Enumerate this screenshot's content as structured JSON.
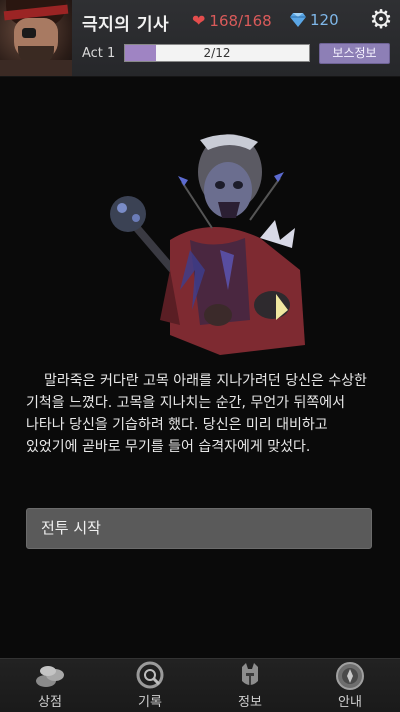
{
  "header": {
    "title": "극지의 기사",
    "hp": "168/168",
    "gems": "120",
    "act_label": "Act 1",
    "progress_text": "2/12",
    "progress_fraction": 0.1667,
    "boss_info_button": "보스정보",
    "icons": {
      "hp": "heart-icon",
      "gems": "diamond-icon",
      "settings": "gear-icon"
    },
    "colors": {
      "hp": "#e44d4d",
      "gems": "#7fb7e9",
      "progress_fill": "#9f84c3",
      "boss_button": "#8d7fb6"
    }
  },
  "story": {
    "text": "말라죽은 커다란 고목 아래를 지나가려던 당신은 수상한 기척을 느꼈다. 고목을 지나치는 순간, 무언가 뒤쪽에서 나타나 당신을 기습하려 했다. 당신은 미리 대비하고 있었기에 곧바로 무기를 들어 습격자에게 맞섰다."
  },
  "actions": {
    "start_battle": "전투 시작"
  },
  "bottom_nav": [
    {
      "label": "상점",
      "icon": "coins-icon"
    },
    {
      "label": "기록",
      "icon": "magnifier-icon"
    },
    {
      "label": "정보",
      "icon": "helmet-icon"
    },
    {
      "label": "안내",
      "icon": "compass-icon"
    }
  ]
}
